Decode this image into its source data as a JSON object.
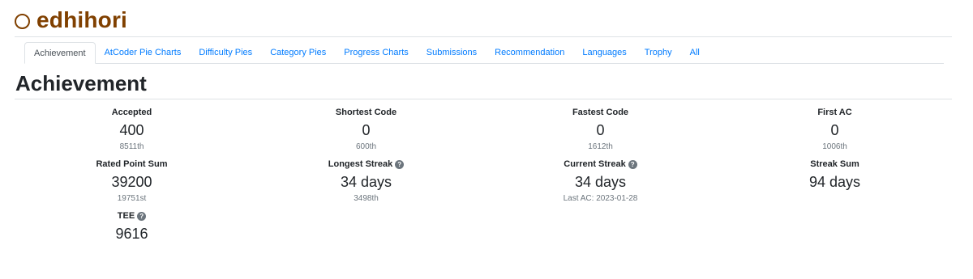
{
  "user": {
    "name": "edhihori",
    "rank_color": "#804000"
  },
  "tabs": [
    {
      "label": "Achievement",
      "active": true
    },
    {
      "label": "AtCoder Pie Charts",
      "active": false
    },
    {
      "label": "Difficulty Pies",
      "active": false
    },
    {
      "label": "Category Pies",
      "active": false
    },
    {
      "label": "Progress Charts",
      "active": false
    },
    {
      "label": "Submissions",
      "active": false
    },
    {
      "label": "Recommendation",
      "active": false
    },
    {
      "label": "Languages",
      "active": false
    },
    {
      "label": "Trophy",
      "active": false
    },
    {
      "label": "All",
      "active": false
    }
  ],
  "page": {
    "title": "Achievement"
  },
  "stats": {
    "accepted": {
      "label": "Accepted",
      "value": "400",
      "sub": "8511th"
    },
    "shortest_code": {
      "label": "Shortest Code",
      "value": "0",
      "sub": "600th"
    },
    "fastest_code": {
      "label": "Fastest Code",
      "value": "0",
      "sub": "1612th"
    },
    "first_ac": {
      "label": "First AC",
      "value": "0",
      "sub": "1006th"
    },
    "rated_point_sum": {
      "label": "Rated Point Sum",
      "value": "39200",
      "sub": "19751st"
    },
    "longest_streak": {
      "label": "Longest Streak",
      "value": "34 days",
      "sub": "3498th"
    },
    "current_streak": {
      "label": "Current Streak",
      "value": "34 days",
      "sub": "Last AC: 2023-01-28"
    },
    "streak_sum": {
      "label": "Streak Sum",
      "value": "94 days"
    },
    "tee": {
      "label": "TEE",
      "value": "9616"
    }
  },
  "icons": {
    "help": "?"
  },
  "colors": {
    "link": "#007bff",
    "muted": "#6c757d"
  }
}
